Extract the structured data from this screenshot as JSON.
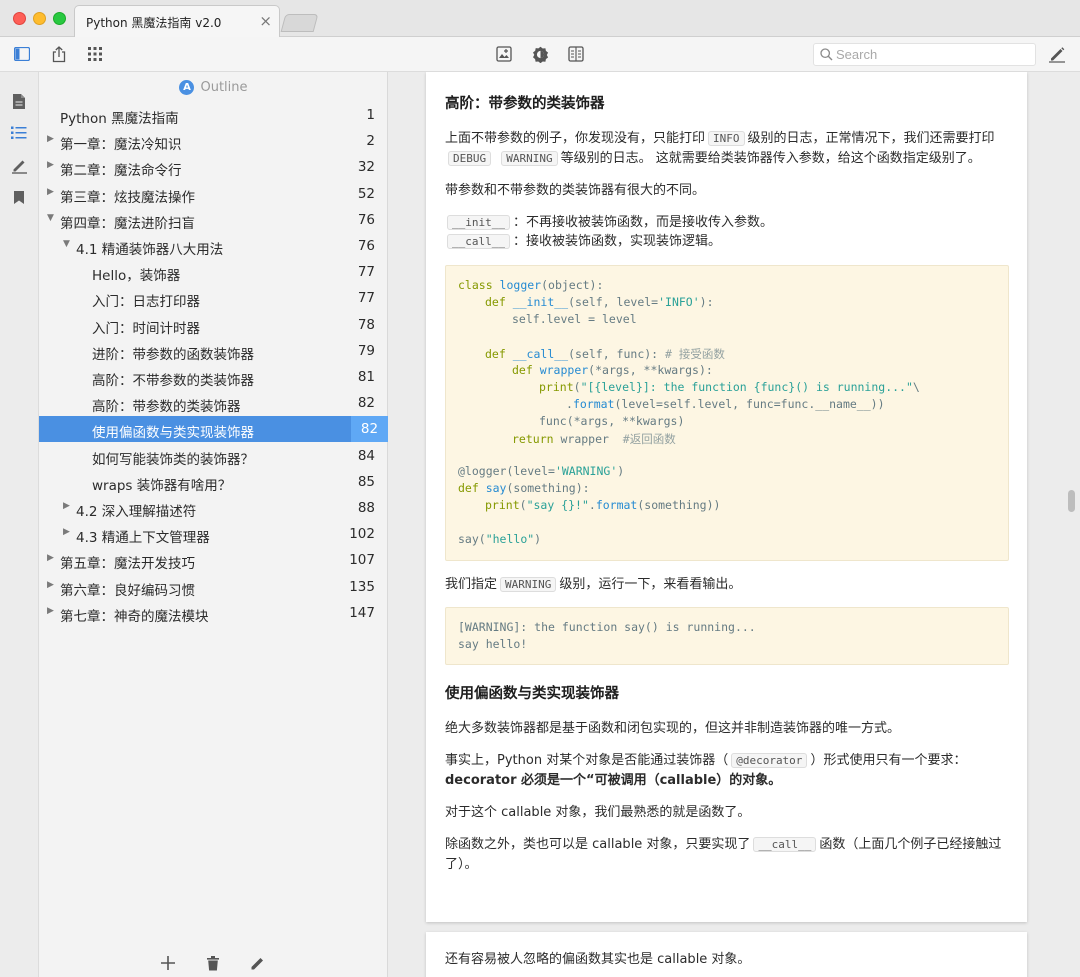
{
  "window": {
    "tab_title": "Python 黑魔法指南 v2.0",
    "tab_close": "×"
  },
  "toolbar": {
    "search_placeholder": "Search"
  },
  "outline": {
    "header": "Outline",
    "badge": "A",
    "items": [
      {
        "label": "Python 黑魔法指南",
        "page": "1",
        "level": 0,
        "arrow": ""
      },
      {
        "label": "第一章：魔法冷知识",
        "page": "2",
        "level": 0,
        "arrow": "▶"
      },
      {
        "label": "第二章：魔法命令行",
        "page": "32",
        "level": 0,
        "arrow": "▶"
      },
      {
        "label": "第三章：炫技魔法操作",
        "page": "52",
        "level": 0,
        "arrow": "▶"
      },
      {
        "label": "第四章：魔法进阶扫盲",
        "page": "76",
        "level": 0,
        "arrow": "▼"
      },
      {
        "label": "4.1 精通装饰器八大用法",
        "page": "76",
        "level": 1,
        "arrow": "▼"
      },
      {
        "label": "Hello，装饰器",
        "page": "77",
        "level": 2,
        "arrow": ""
      },
      {
        "label": "入门：日志打印器",
        "page": "77",
        "level": 2,
        "arrow": ""
      },
      {
        "label": "入门：时间计时器",
        "page": "78",
        "level": 2,
        "arrow": ""
      },
      {
        "label": "进阶：带参数的函数装饰器",
        "page": "79",
        "level": 2,
        "arrow": ""
      },
      {
        "label": "高阶：不带参数的类装饰器",
        "page": "81",
        "level": 2,
        "arrow": ""
      },
      {
        "label": "高阶：带参数的类装饰器",
        "page": "82",
        "level": 2,
        "arrow": ""
      },
      {
        "label": "使用偏函数与类实现装饰器",
        "page": "82",
        "level": 2,
        "arrow": "",
        "selected": true
      },
      {
        "label": "如何写能装饰类的装饰器？",
        "page": "84",
        "level": 2,
        "arrow": ""
      },
      {
        "label": "wraps 装饰器有啥用？",
        "page": "85",
        "level": 2,
        "arrow": ""
      },
      {
        "label": "4.2 深入理解描述符",
        "page": "88",
        "level": 1,
        "arrow": "▶"
      },
      {
        "label": "4.3 精通上下文管理器",
        "page": "102",
        "level": 1,
        "arrow": "▶"
      },
      {
        "label": "第五章：魔法开发技巧",
        "page": "107",
        "level": 0,
        "arrow": "▶"
      },
      {
        "label": "第六章：良好编码习惯",
        "page": "135",
        "level": 0,
        "arrow": "▶"
      },
      {
        "label": "第七章：神奇的魔法模块",
        "page": "147",
        "level": 0,
        "arrow": "▶"
      }
    ]
  },
  "content": {
    "heading1": "高阶：带参数的类装饰器",
    "p1_a": "上面不带参数的例子，你发现没有，只能打印",
    "p1_code1": "INFO",
    "p1_b": "级别的日志，正常情况下，我们还需要打印",
    "p1_code2": "DEBUG",
    "p1_code3": "WARNING",
    "p1_c": "等级别的日志。 这就需要给类装饰器传入参数，给这个函数指定级别了。",
    "p2": "带参数和不带参数的类装饰器有很大的不同。",
    "li1_code": "__init__",
    "li1_text": "：不再接收被装饰函数，而是接收传入参数。",
    "li2_code": "__call__",
    "li2_text": "：接收被装饰函数，实现装饰逻辑。",
    "code1": {
      "l1_kw": "class ",
      "l1_fn": "logger",
      "l1_rest": "(object):",
      "l2_kw": "def ",
      "l2_fn": "__init__",
      "l2_rest": "(self, level=",
      "l2_str": "'INFO'",
      "l2_end": "):",
      "l3": "self.level = level",
      "l5_kw": "def ",
      "l5_fn": "__call__",
      "l5_rest": "(self, func): ",
      "l5_cm": "# 接受函数",
      "l6_kw": "def ",
      "l6_fn": "wrapper",
      "l6_rest": "(*args, **kwargs):",
      "l7_fn": "print",
      "l7_rest": "(",
      "l7_str": "\"[{level}]: the function {func}() is running...\"",
      "l7_end": "\\",
      "l8_dot": ".",
      "l8_fn": "format",
      "l8_rest": "(level=self.level, func=func.__name__))",
      "l9": "func(*args, **kwargs)",
      "l10_kw": "return ",
      "l10_rest": "wrapper  ",
      "l10_cm": "#返回函数",
      "l12_a": "@logger(level=",
      "l12_str": "'WARNING'",
      "l12_b": ")",
      "l13_kw": "def ",
      "l13_fn": "say",
      "l13_rest": "(something):",
      "l14_fn": "print",
      "l14_rest": "(",
      "l14_str": "\"say {}!\"",
      "l14_dot": ".",
      "l14_fn2": "format",
      "l14_end": "(something))",
      "l16_a": "say(",
      "l16_str": "\"hello\"",
      "l16_b": ")"
    },
    "p3_a": "我们指定",
    "p3_code": "WARNING",
    "p3_b": "级别，运行一下，来看看输出。",
    "output": {
      "l1": "[WARNING]: the function say() is running...",
      "l2": "say hello!"
    },
    "heading2": "使用偏函数与类实现装饰器",
    "p4": "绝大多数装饰器都是基于函数和闭包实现的，但这并非制造装饰器的唯一方式。",
    "p5_a": "事实上，Python 对某个对象是否能通过装饰器（",
    "p5_code": "@decorator",
    "p5_b": "）形式使用只有一个要求：",
    "p5_bold": "decorator 必须是一个“可被调用（callable）的对象。",
    "p6": "对于这个 callable 对象，我们最熟悉的就是函数了。",
    "p7_a": "除函数之外，类也可以是 callable 对象，只要实现了",
    "p7_code": "__call__",
    "p7_b": "函数（上面几个例子已经接触过了）。",
    "p8": "还有容易被人忽略的偏函数其实也是 callable 对象。"
  }
}
